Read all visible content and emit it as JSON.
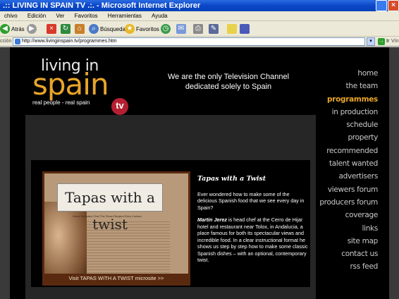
{
  "window": {
    "title": ".:: LIVING IN SPAIN TV .:. - Microsoft Internet Explorer"
  },
  "menu": {
    "items": [
      "chivo",
      "Edición",
      "Ver",
      "Favoritos",
      "Herramientas",
      "Ayuda"
    ]
  },
  "toolbar": {
    "back_label": "Atrás",
    "search_label": "Búsqueda",
    "favorites_label": "Favoritos"
  },
  "address": {
    "label": "cción",
    "url": "http://www.livinginspain.tv/programmes.htm",
    "go_label": "Ir",
    "links_label": "Vín"
  },
  "site": {
    "logo": {
      "top": "living in",
      "main": "spain",
      "tagline": "real people - real spain",
      "badge": "tv"
    },
    "header_tagline": "We are the only Television Channel dedicated solely to Spain",
    "nav": [
      "home",
      "the team",
      "programmes",
      "in production",
      "schedule",
      "property",
      "recommended",
      "talent wanted",
      "advertisers",
      "viewers forum",
      "producers forum",
      "coverage",
      "links",
      "site map",
      "contact us",
      "rss feed"
    ],
    "active_nav": "programmes"
  },
  "feature": {
    "image_title": "Tapas with a twist",
    "image_nav": "Home  Episodes  Chef  The Show  Recipes  Extra  Contact",
    "microsite_link": "Visit TAPAS WITH A TWIST microsite >>",
    "heading": "Tapas with a Twist",
    "intro": "Ever wondered how to make some of the delicious Spanish food that we see every day in Spain?",
    "chef_name": "Martin Jerez",
    "body": " is head chef at the Cerro de Hijar hotel and restaurant near Tolox, in Andalucia, a place famous for both its spectacular views and incredible food. In a clear instructional format he shows us step by step how to make some classic Spanish dishes – with an optional, contemporary twist."
  }
}
